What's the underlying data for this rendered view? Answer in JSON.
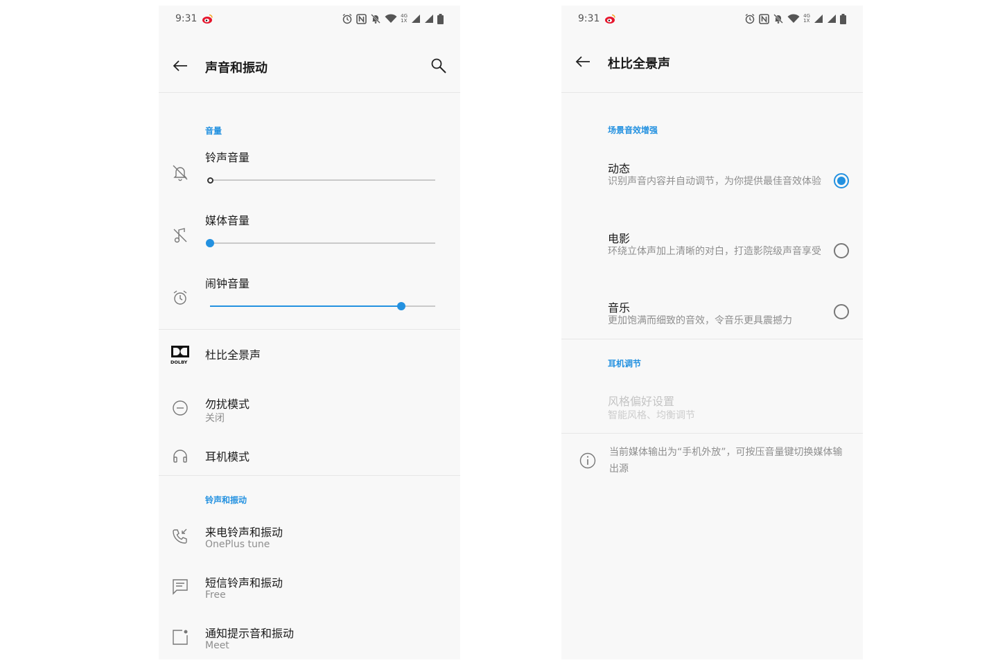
{
  "colors": {
    "accent": "#2391e0",
    "background": "#f8f8f8",
    "text_primary": "#1a1a1a",
    "text_secondary": "#8e8e8e"
  },
  "status_bar": {
    "time": "9:31",
    "icons": [
      "weibo-icon",
      "alarm-icon",
      "nfc-icon",
      "mute-bell-icon",
      "wifi-icon",
      "network-4g-icon",
      "signal-icon",
      "battery-icon"
    ],
    "network_top": "4G",
    "network_bottom": "1X"
  },
  "left": {
    "title": "声音和振动",
    "volume": {
      "header": "音量",
      "ringtone": {
        "label": "铃声音量",
        "level": 0
      },
      "media": {
        "label": "媒体音量",
        "level": 0
      },
      "alarm": {
        "label": "闹钟音量",
        "level": 0.85
      }
    },
    "dolby": {
      "label": "杜比全景声",
      "logo_text": "DOLBY"
    },
    "dnd": {
      "label": "勿扰模式",
      "value": "关闭"
    },
    "headphone": {
      "label": "耳机模式"
    },
    "ring_vibration": {
      "header": "铃声和振动",
      "call": {
        "label": "来电铃声和振动",
        "value": "OnePlus tune"
      },
      "sms": {
        "label": "短信铃声和振动",
        "value": "Free"
      },
      "notification": {
        "label": "通知提示音和振动",
        "value": "Meet"
      }
    }
  },
  "right": {
    "title": "杜比全景声",
    "scene": {
      "header": "场景音效增强",
      "selected": 0,
      "options": [
        {
          "title": "动态",
          "desc": "识别声音内容并自动调节，为你提供最佳音效体验"
        },
        {
          "title": "电影",
          "desc": "环绕立体声加上清晰的对白，打造影院级声音享受"
        },
        {
          "title": "音乐",
          "desc": "更加饱满而细致的音效，令音乐更具震撼力"
        }
      ]
    },
    "headphone_tuning": {
      "header": "耳机调节",
      "style": {
        "label": "风格偏好设置",
        "sub": "智能风格、均衡调节"
      }
    },
    "info": "当前媒体输出为“手机外放”，可按压音量键切换媒体输出源"
  }
}
